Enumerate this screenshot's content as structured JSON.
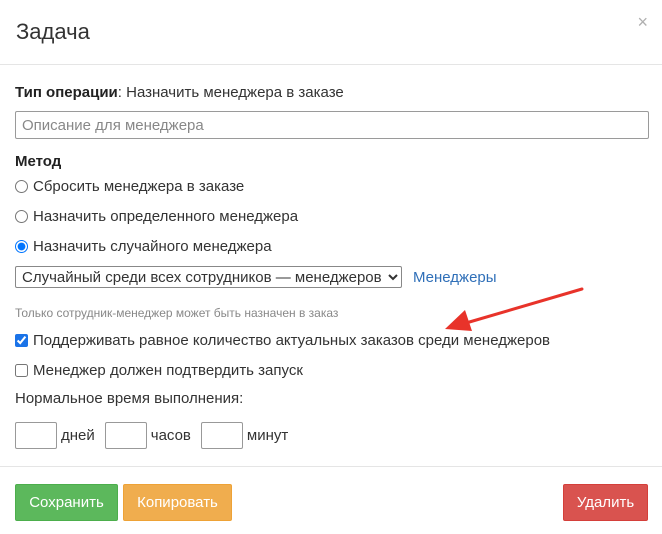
{
  "dialog": {
    "title": "Задача",
    "close_symbol": "×"
  },
  "operation": {
    "label": "Тип операции",
    "separator": ": ",
    "value": "Назначить менеджера в заказе"
  },
  "description": {
    "placeholder": "Описание для менеджера",
    "value": ""
  },
  "method": {
    "label": "Метод",
    "options": [
      {
        "label": "Сбросить менеджера в заказе",
        "checked": false
      },
      {
        "label": "Назначить определенного менеджера",
        "checked": false
      },
      {
        "label": "Назначить случайного менеджера",
        "checked": true
      }
    ]
  },
  "random_select": {
    "selected": "Случайный среди всех сотрудников — менеджеров",
    "link": "Менеджеры"
  },
  "note": "Только сотрудник-менеджер может быть назначен в заказ",
  "checkboxes": [
    {
      "label": "Поддерживать равное количество актуальных заказов среди менеджеров",
      "checked": true
    },
    {
      "label": "Менеджер должен подтвердить запуск",
      "checked": false
    }
  ],
  "normal_time": {
    "label": "Нормальное время выполнения:",
    "days_label": "дней",
    "hours_label": "часов",
    "minutes_label": "минут",
    "days": "",
    "hours": "",
    "minutes": ""
  },
  "buttons": {
    "save": "Сохранить",
    "copy": "Копировать",
    "delete": "Удалить"
  },
  "colors": {
    "save": "#5cb85c",
    "copy": "#f0ad4e",
    "delete": "#d9534f",
    "link": "#2f6fb8",
    "arrow": "#e8332a"
  }
}
